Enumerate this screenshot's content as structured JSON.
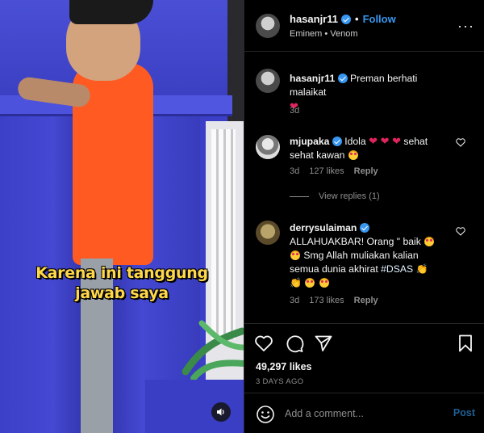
{
  "video": {
    "subtitle_line1": "Karena ini tanggung",
    "subtitle_line2": "jawab saya"
  },
  "header": {
    "username": "hasanjr11",
    "separator": "•",
    "follow_label": "Follow",
    "audio": "Eminem • Venom",
    "more": "···"
  },
  "caption": {
    "username": "hasanjr11",
    "text": "Preman berhati malaikat",
    "time": "3d"
  },
  "comments": [
    {
      "username": "mjupaka",
      "text_a": "Idola",
      "text_b": "sehat sehat kawan",
      "time": "3d",
      "likes": "127 likes",
      "reply": "Reply",
      "view_replies": "View replies (1)"
    },
    {
      "username": "derrysulaiman",
      "text_a": "ALLAHUAKBAR! Orang \" baik",
      "text_b": "Smg Allah muliakan kalian semua dunia akhirat",
      "hashtag": "#DSAS",
      "time": "3d",
      "likes": "173 likes",
      "reply": "Reply"
    }
  ],
  "stats": {
    "likes": "49,297 likes",
    "ago": "3 DAYS AGO"
  },
  "add_comment": {
    "placeholder": "Add a comment...",
    "post_label": "Post"
  },
  "colors": {
    "link_blue": "#3897f0",
    "heart_red": "#e0245e",
    "subtitle_yellow": "#ffd84a"
  }
}
